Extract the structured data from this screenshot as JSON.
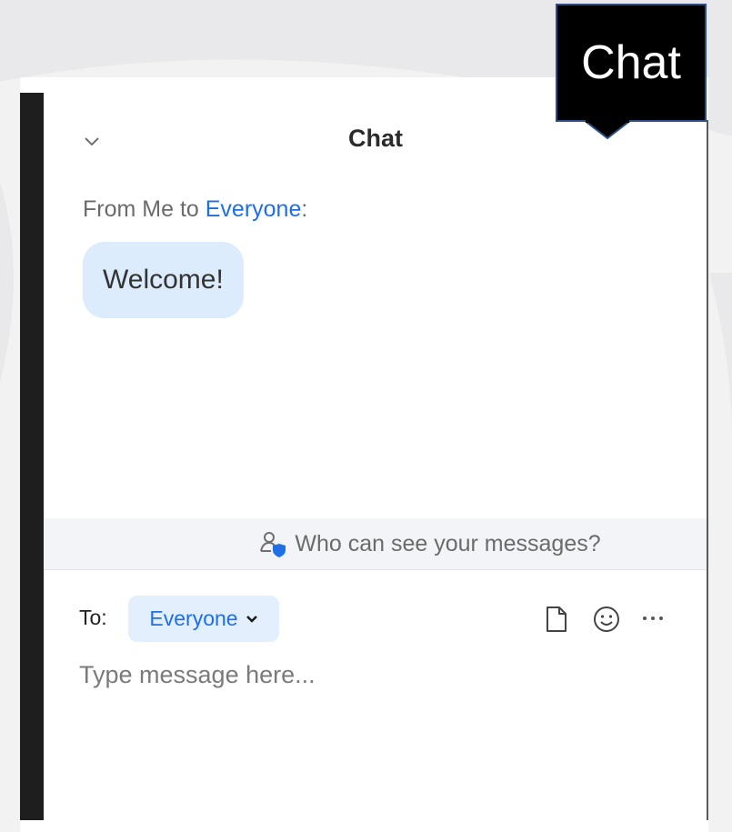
{
  "tooltip": {
    "text": "Chat"
  },
  "chat": {
    "title": "Chat",
    "message_header": {
      "prefix": "From Me to ",
      "recipient": "Everyone",
      "suffix": ":"
    },
    "message_text": "Welcome!",
    "privacy_notice": "Who can see your messages?",
    "to_label": "To:",
    "recipient_select": "Everyone",
    "input_placeholder": "Type message here..."
  },
  "icons": {
    "collapse": "chevron-down-icon",
    "privacy": "person-shield-icon",
    "file": "file-icon",
    "emoji": "emoji-icon",
    "more": "more-icon",
    "chip_caret": "chevron-down-icon"
  },
  "colors": {
    "accent": "#1f6fe5",
    "bubble": "#dcecfc",
    "chip": "#e4effd",
    "privacy_bar": "#f3f4f8",
    "sidebar": "#1e1e1e"
  }
}
